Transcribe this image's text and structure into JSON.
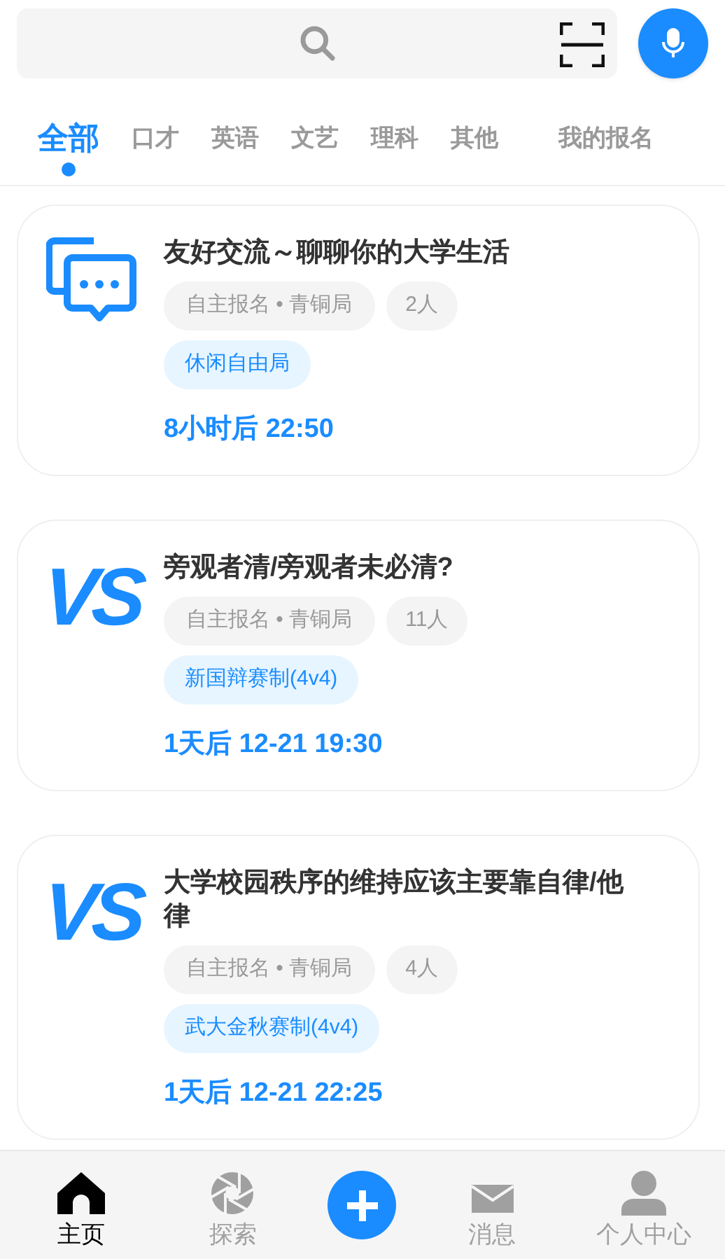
{
  "tabs": [
    {
      "label": "全部",
      "selected": true
    },
    {
      "label": "口才",
      "selected": false
    },
    {
      "label": "英语",
      "selected": false
    },
    {
      "label": "文艺",
      "selected": false
    },
    {
      "label": "理科",
      "selected": false
    },
    {
      "label": "其他",
      "selected": false
    },
    {
      "label": "我的报名",
      "selected": false
    }
  ],
  "cards": [
    {
      "kind": "chat",
      "title": "友好交流～聊聊你的大学生活",
      "mode": "自主报名 • 青铜局",
      "people": "2人",
      "format": "休闲自由局",
      "time": "8小时后 22:50"
    },
    {
      "kind": "vs",
      "badge": "VS",
      "title": "旁观者清/旁观者未必清?",
      "mode": "自主报名 • 青铜局",
      "people": "11人",
      "format": "新国辩赛制(4v4)",
      "time": "1天后 12-21 19:30"
    },
    {
      "kind": "vs",
      "badge": "VS",
      "title": "大学校园秩序的维持应该主要靠自律/他律",
      "mode": "自主报名 • 青铜局",
      "people": "4人",
      "format": "武大金秋赛制(4v4)",
      "time": "1天后 12-21 22:25"
    }
  ],
  "nav": [
    {
      "kind": "home",
      "label": "主页",
      "selected": true
    },
    {
      "kind": "explore",
      "label": "探索",
      "selected": false
    },
    {
      "kind": "add",
      "selected": false
    },
    {
      "kind": "mail",
      "label": "消息",
      "selected": false
    },
    {
      "kind": "user",
      "label": "个人中心",
      "selected": false
    }
  ]
}
